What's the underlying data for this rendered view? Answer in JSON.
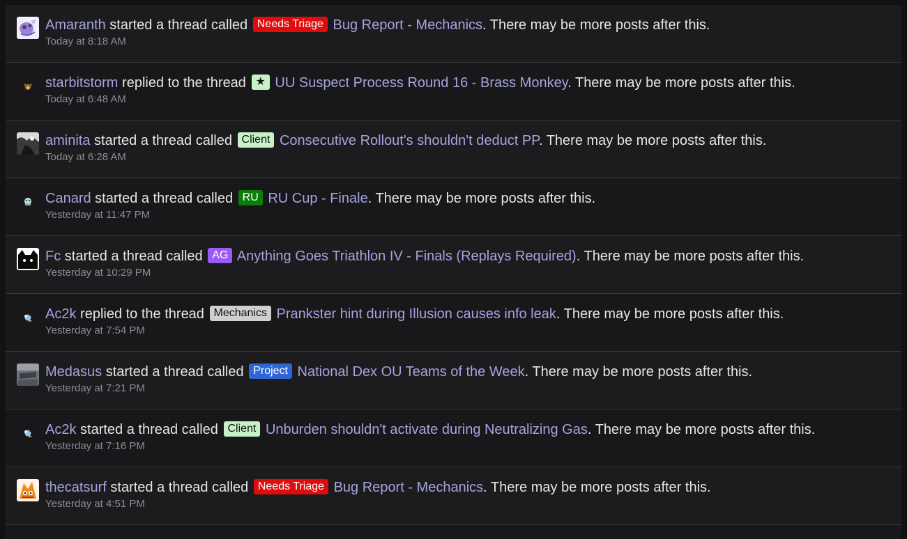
{
  "items": [
    {
      "user": "Amaranth",
      "action": "started a thread called",
      "label": "Needs Triage",
      "label_bg": "#e00b0b",
      "label_fg": "#ffffff",
      "title": "Bug Report - Mechanics",
      "tail": ". There may be more posts after this.",
      "time": "Today at 8:18 AM",
      "avatar_icon": "lavender-creature-avatar"
    },
    {
      "user": "starbitstorm",
      "action": "replied to the thread",
      "label": "★",
      "label_bg": "#c7f2c7",
      "label_fg": "#111111",
      "title": "UU Suspect Process Round 16 - Brass Monkey",
      "tail": ". There may be more posts after this.",
      "time": "Today at 6:48 AM",
      "avatar_icon": "monkey-sprite-avatar"
    },
    {
      "user": "aminita",
      "action": "started a thread called",
      "label": "Client",
      "label_bg": "#c7f2c7",
      "label_fg": "#111111",
      "title": "Consecutive Rollout's shouldn't deduct PP",
      "tail": ". There may be more posts after this.",
      "time": "Today at 6:28 AM",
      "avatar_icon": "grayscale-photo-avatar"
    },
    {
      "user": "Canard",
      "action": "started a thread called",
      "label": "RU",
      "label_bg": "#0b7d0b",
      "label_fg": "#ffffff",
      "title": "RU Cup - Finale",
      "tail": ". There may be more posts after this.",
      "time": "Yesterday at 11:47 PM",
      "avatar_icon": "ghost-sprite-avatar"
    },
    {
      "user": "Fc",
      "action": "started a thread called",
      "label": "AG",
      "label_bg": "#9b59f5",
      "label_fg": "#ffffff",
      "title": "Anything Goes Triathlon IV - Finals (Replays Required)",
      "tail": ". There may be more posts after this.",
      "time": "Yesterday at 10:29 PM",
      "avatar_icon": "black-cat-avatar"
    },
    {
      "user": "Ac2k",
      "action": "replied to the thread",
      "label": "Mechanics",
      "label_bg": "#cfcfcf",
      "label_fg": "#111111",
      "title": "Prankster hint during Illusion causes info leak",
      "tail": ". There may be more posts after this.",
      "time": "Yesterday at 7:54 PM",
      "avatar_icon": "bird-sprite-avatar"
    },
    {
      "user": "Medasus",
      "action": "started a thread called",
      "label": "Project",
      "label_bg": "#2f66d6",
      "label_fg": "#ffffff",
      "title": "National Dex OU Teams of the Week",
      "tail": ". There may be more posts after this.",
      "time": "Yesterday at 7:21 PM",
      "avatar_icon": "gray-photo-avatar"
    },
    {
      "user": "Ac2k",
      "action": "started a thread called",
      "label": "Client",
      "label_bg": "#c7f2c7",
      "label_fg": "#111111",
      "title": "Unburden shouldn't activate during Neutralizing Gas",
      "tail": ". There may be more posts after this.",
      "time": "Yesterday at 7:16 PM",
      "avatar_icon": "bird-sprite-avatar"
    },
    {
      "user": "thecatsurf",
      "action": "started a thread called",
      "label": "Needs Triage",
      "label_bg": "#e00b0b",
      "label_fg": "#ffffff",
      "title": "Bug Report - Mechanics",
      "tail": ". There may be more posts after this.",
      "time": "Yesterday at 4:51 PM",
      "avatar_icon": "orange-creature-avatar"
    }
  ]
}
